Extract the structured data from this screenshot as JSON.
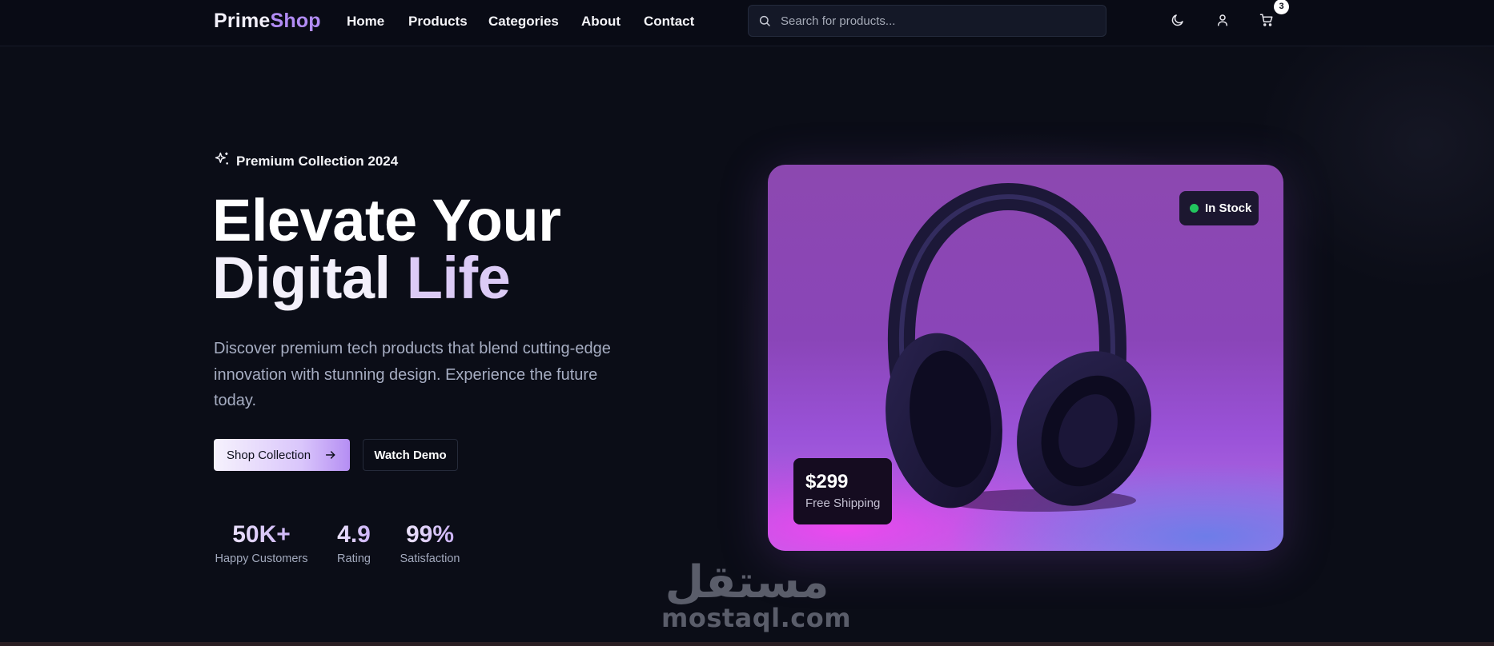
{
  "nav": {
    "logo_part1": "Prime",
    "logo_part2": "Shop",
    "links": [
      "Home",
      "Products",
      "Categories",
      "About",
      "Contact"
    ],
    "search_placeholder": "Search for products...",
    "icons": [
      "moon-icon",
      "user-icon",
      "cart-icon"
    ],
    "cart_count": "3"
  },
  "hero": {
    "eyebrow": "Premium Collection 2024",
    "headline_line1": "Elevate Your",
    "headline_line2_a": "Digital",
    "headline_line2_b": "Life",
    "description": "Discover premium tech products that blend cutting-edge innovation with stunning design. Experience the future today.",
    "primary_button": "Shop Collection",
    "secondary_button": "Watch Demo",
    "stats": [
      {
        "value": "50K+",
        "label": "Happy Customers"
      },
      {
        "value": "4.9",
        "label": "Rating"
      },
      {
        "value": "99%",
        "label": "Satisfaction"
      }
    ]
  },
  "product_card": {
    "stock_badge": "In Stock",
    "price": "$299",
    "shipping": "Free Shipping"
  },
  "watermark": {
    "arabic": "مستقل",
    "latin": "mostaql.com"
  },
  "colors": {
    "background": "#0b0d17",
    "accent": "#b28cf5",
    "stock_dot": "#22c55e"
  }
}
